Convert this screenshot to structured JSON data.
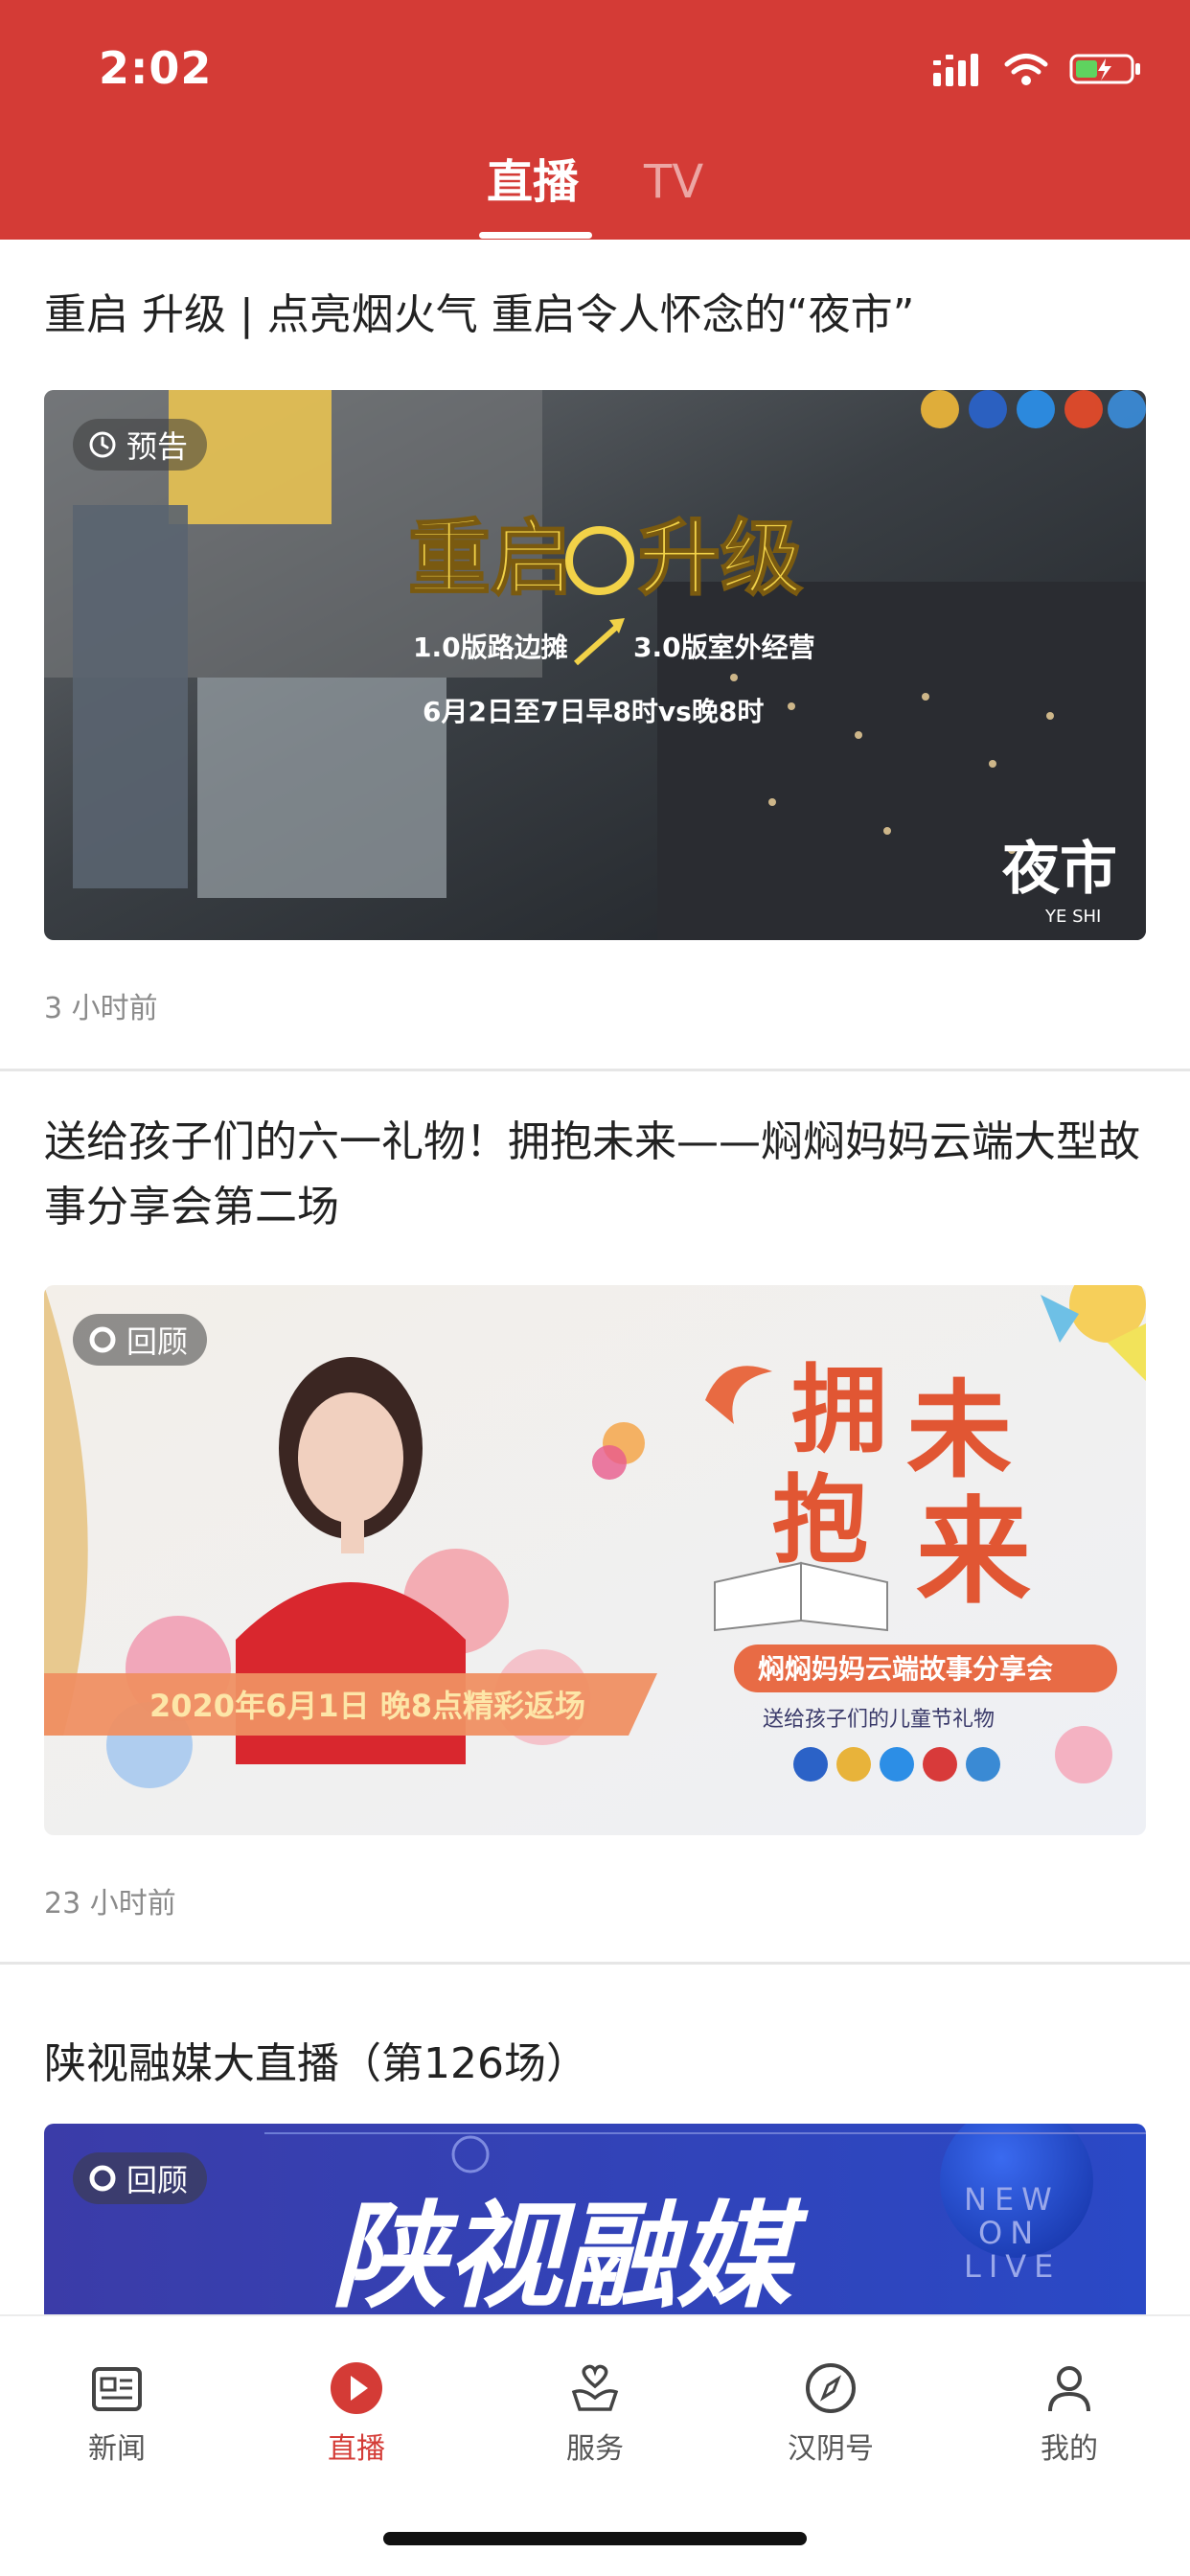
{
  "status_bar": {
    "time": "2:02"
  },
  "top_tabs": [
    {
      "label": "直播"
    },
    {
      "label": "TV"
    }
  ],
  "colors": {
    "brand_red": "#d43b36",
    "meta_gray": "#8a8a8a",
    "divider": "#e6e6e6"
  },
  "feed": [
    {
      "title": "重启 升级 | 点亮烟火气 重启令人怀念的“夜市”",
      "badge": "预告",
      "badge_icon": "clock-icon",
      "time_ago": "3 小时前",
      "image_text": {
        "headline": "重启",
        "headline2": "升级",
        "line1_left": "1.0版路边摊",
        "line1_right": "3.0版室外经营",
        "line2": "6月2日至7日早8时vs晚8时",
        "corner": "夜市",
        "corner_sub": "YE SHI"
      }
    },
    {
      "title": "送给孩子们的六一礼物！拥抱未来——焖焖妈妈云端大型故事分享会第二场",
      "badge": "回顾",
      "badge_icon": "replay-icon",
      "time_ago": "23 小时前",
      "image_text": {
        "title_chars": [
          "拥",
          "未",
          "抱",
          "来"
        ],
        "subtitle": "焖焖妈妈云端故事分享会",
        "tagline": "送给孩子们的儿童节礼物",
        "banner": "2020年6月1日 晚8点精彩返场"
      }
    },
    {
      "title": "陕视融媒大直播（第126场）",
      "badge": "回顾",
      "badge_icon": "replay-icon",
      "image_text": {
        "headline": "陕视融媒",
        "side_lines": [
          "NEW",
          "ON",
          "LIVE"
        ]
      }
    }
  ],
  "bottom_nav": [
    {
      "label": "新闻",
      "icon": "newspaper-icon"
    },
    {
      "label": "直播",
      "icon": "play-icon",
      "active": true
    },
    {
      "label": "服务",
      "icon": "heart-hand-icon"
    },
    {
      "label": "汉阴号",
      "icon": "compass-icon"
    },
    {
      "label": "我的",
      "icon": "user-icon"
    }
  ]
}
